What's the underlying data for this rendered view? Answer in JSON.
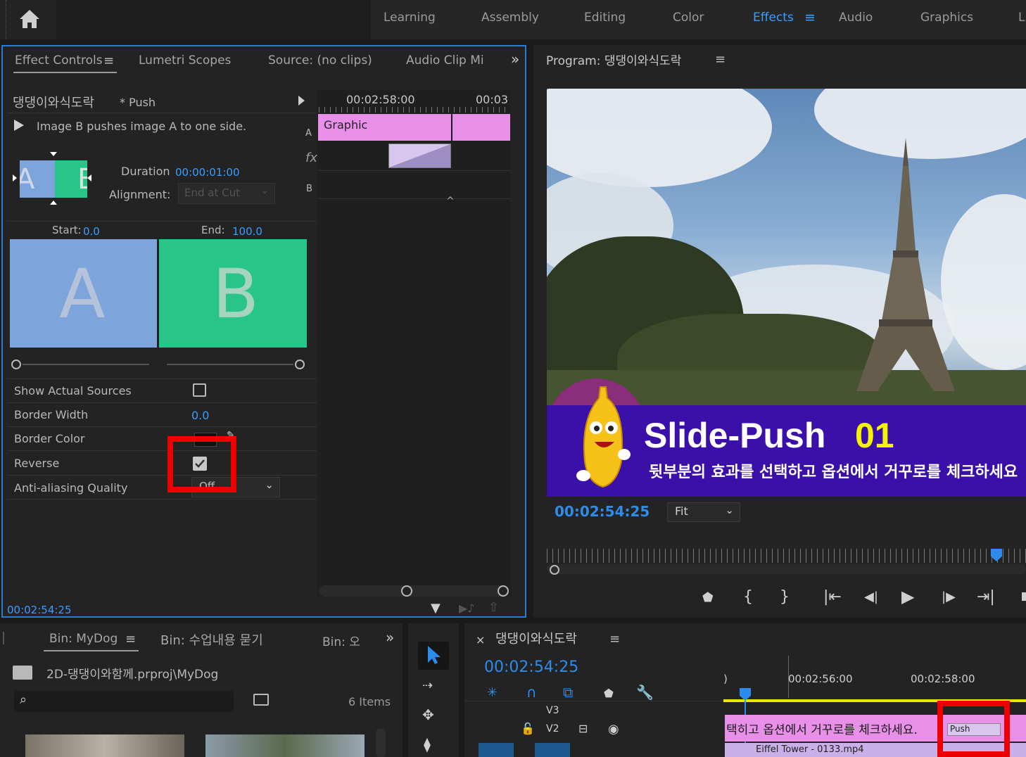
{
  "workspaces": [
    "Learning",
    "Assembly",
    "Editing",
    "Color",
    "Effects",
    "Audio",
    "Graphics",
    "L"
  ],
  "active_workspace": "Effects",
  "effect_panel": {
    "tabs": [
      "Effect Controls",
      "Lumetri Scopes",
      "Source: (no clips)",
      "Audio Clip Mi"
    ],
    "sequence_name": "댕댕이와식도락",
    "effect_name": "* Push",
    "description": "Image B pushes image A to one side.",
    "duration_label": "Duration",
    "duration_value": "00:00:01:00",
    "alignment_label": "Alignment:",
    "alignment_value": "End at Cut",
    "start_label": "Start:",
    "start_value": "0.0",
    "end_label": "End:",
    "end_value": "100.0",
    "preview_a": "A",
    "preview_b": "B",
    "thumb_a_letter": "A",
    "thumb_b_letter": "B",
    "props": {
      "show_actual_sources": "Show Actual Sources",
      "border_width": "Border Width",
      "border_width_value": "0.0",
      "border_color": "Border Color",
      "reverse": "Reverse",
      "anti_aliasing": "Anti-aliasing Quality",
      "anti_aliasing_value": "Off"
    },
    "timeline_ruler_1": "00:02:58:00",
    "timeline_ruler_2": "00:03",
    "track_a": "A",
    "track_fx": "fx",
    "track_b": "B",
    "clip_label": "Graphic",
    "timecode": "00:02:54:25"
  },
  "program_panel": {
    "title": "Program: 댕댕이와식도락",
    "timecode": "00:02:54:25",
    "zoom": "Fit",
    "overlay_title": "Slide-Push",
    "overlay_number": "01",
    "overlay_subtitle": "뒷부분의 효과를 선택하고 옵션에서  거꾸로를 체크하세요"
  },
  "bin_panel": {
    "tabs": [
      "Bin: MyDog",
      "Bin: 수업내용 묻기",
      "Bin: 오"
    ],
    "path": "2D-댕댕이와함께.prproj\\MyDog",
    "items_count": "6 Items"
  },
  "timeline_panel": {
    "sequence_name": "댕댕이와식도락",
    "timecode": "00:02:54:25",
    "ruler_1": "00:02:56:00",
    "ruler_2": "00:02:58:00",
    "ruler_0": ")",
    "track_v3": "V3",
    "track_v2": "V2",
    "caption_clip": "택히고 옵션에서 거꾸로를 체크하세요.",
    "transition_label": "Push",
    "bottom_clip": "Eiffel Tower - 0133.mp4"
  },
  "colors": {
    "accent_blue": "#2d8ceb",
    "clip_pink": "#e88fe8",
    "overlay_purple": "#3a10a8",
    "overlay_yellow": "#f4f400",
    "highlight_red": "#ee0000",
    "preview_a_color": "#7ea4dc",
    "preview_b_color": "#28c488"
  }
}
